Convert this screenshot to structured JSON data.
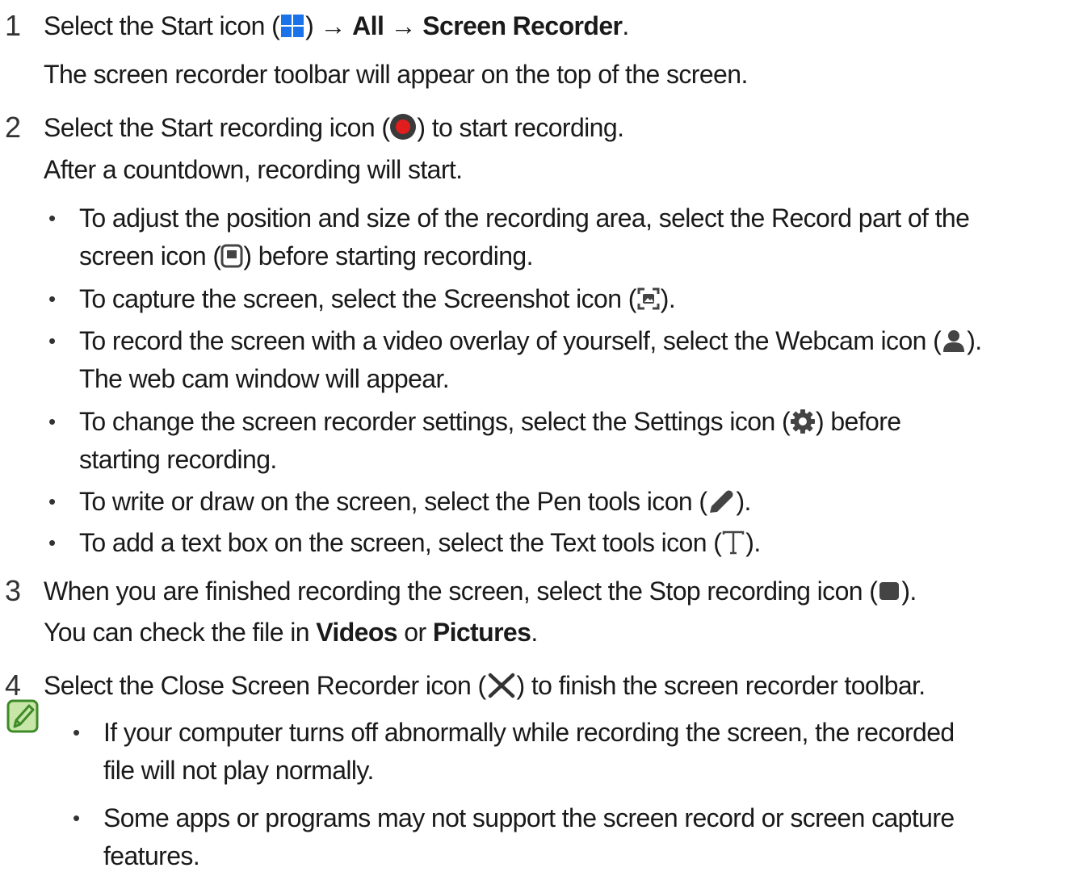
{
  "step1": {
    "number": "1",
    "text_before": "Select the Start icon (",
    "start_icon": "windows-start-icon",
    "text_after": ") → ",
    "path_all": "All",
    "arrow": " → ",
    "path_app": "Screen Recorder",
    "period": ".",
    "description": "The screen recorder toolbar will appear on the top of the screen."
  },
  "step2": {
    "number": "2",
    "text_before": "Select the Start recording icon (",
    "record_icon": "record-icon",
    "text_after": ") to start recording.",
    "description": "After a countdown, recording will start.",
    "bullets": [
      {
        "line1": "To adjust the position and size of the recording area, select the Record part of the",
        "line2_before": "screen icon (",
        "icon": "record-part-of-screen-icon",
        "line2_after": ") before starting recording."
      },
      {
        "before": "To capture the screen, select the Screenshot icon (",
        "icon": "screenshot-icon",
        "after": ")."
      },
      {
        "before": "To record the screen with a video overlay of yourself, select the Webcam icon (",
        "icon": "webcam-icon",
        "after": ").",
        "line2": "The web cam window will appear."
      },
      {
        "before": "To change the screen recorder settings, select the Settings icon (",
        "icon": "settings-icon",
        "after": ") before",
        "line2": "starting recording."
      },
      {
        "before": "To write or draw on the screen, select the Pen tools icon (",
        "icon": "pen-icon",
        "after": ")."
      },
      {
        "before": "To add a text box on the screen, select the Text tools icon (",
        "icon": "text-tool-icon",
        "after": ")."
      }
    ]
  },
  "step3": {
    "number": "3",
    "text_before": "When you are finished recording the screen, select the Stop recording icon (",
    "stop_icon": "stop-icon",
    "text_after": ").",
    "desc_before": "You can check the file in ",
    "videos": "Videos",
    "desc_or": " or ",
    "pictures": "Pictures",
    "desc_period": "."
  },
  "step4": {
    "number": "4",
    "text_before": "Select the Close Screen Recorder icon (",
    "close_icon": "close-icon",
    "text_after": ") to finish the screen recorder toolbar."
  },
  "note": {
    "icon": "note-icon",
    "items": [
      {
        "line1": "If your computer turns off abnormally while recording the screen, the recorded",
        "line2": "file will not play normally."
      },
      {
        "line1": "Some apps or programs may not support the screen record or screen capture",
        "line2": "features."
      }
    ]
  },
  "colors": {
    "windows_blue": "#1a73e8",
    "record_red": "#e01e1e",
    "icon_gray": "#444444",
    "note_green": "#3f8a28",
    "note_fill": "#c7e6a8"
  }
}
